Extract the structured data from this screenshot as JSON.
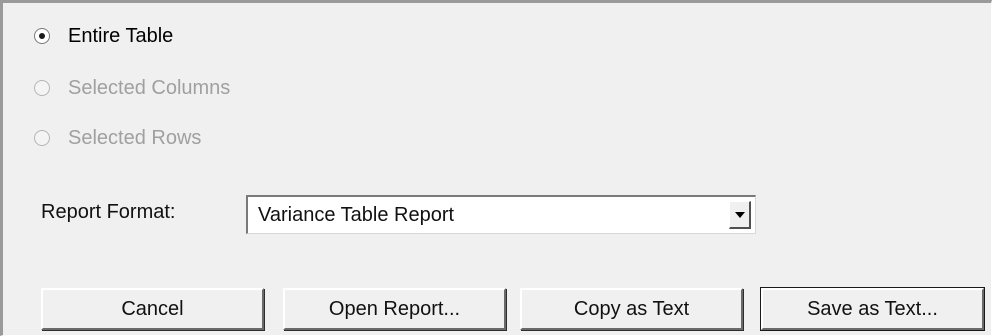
{
  "scope_options": [
    {
      "label": "Entire Table",
      "selected": true,
      "enabled": true
    },
    {
      "label": "Selected Columns",
      "selected": false,
      "enabled": false
    },
    {
      "label": "Selected Rows",
      "selected": false,
      "enabled": false
    }
  ],
  "report_format": {
    "label": "Report Format:",
    "value": "Variance Table Report"
  },
  "buttons": {
    "cancel": "Cancel",
    "open_report": "Open Report...",
    "copy_as_text": "Copy as Text",
    "save_as_text": "Save as Text..."
  },
  "icons": {
    "dropdown": "chevron-down-icon"
  },
  "colors": {
    "dialog_bg": "#f0f0f0",
    "disabled_text": "#a0a0a0"
  }
}
